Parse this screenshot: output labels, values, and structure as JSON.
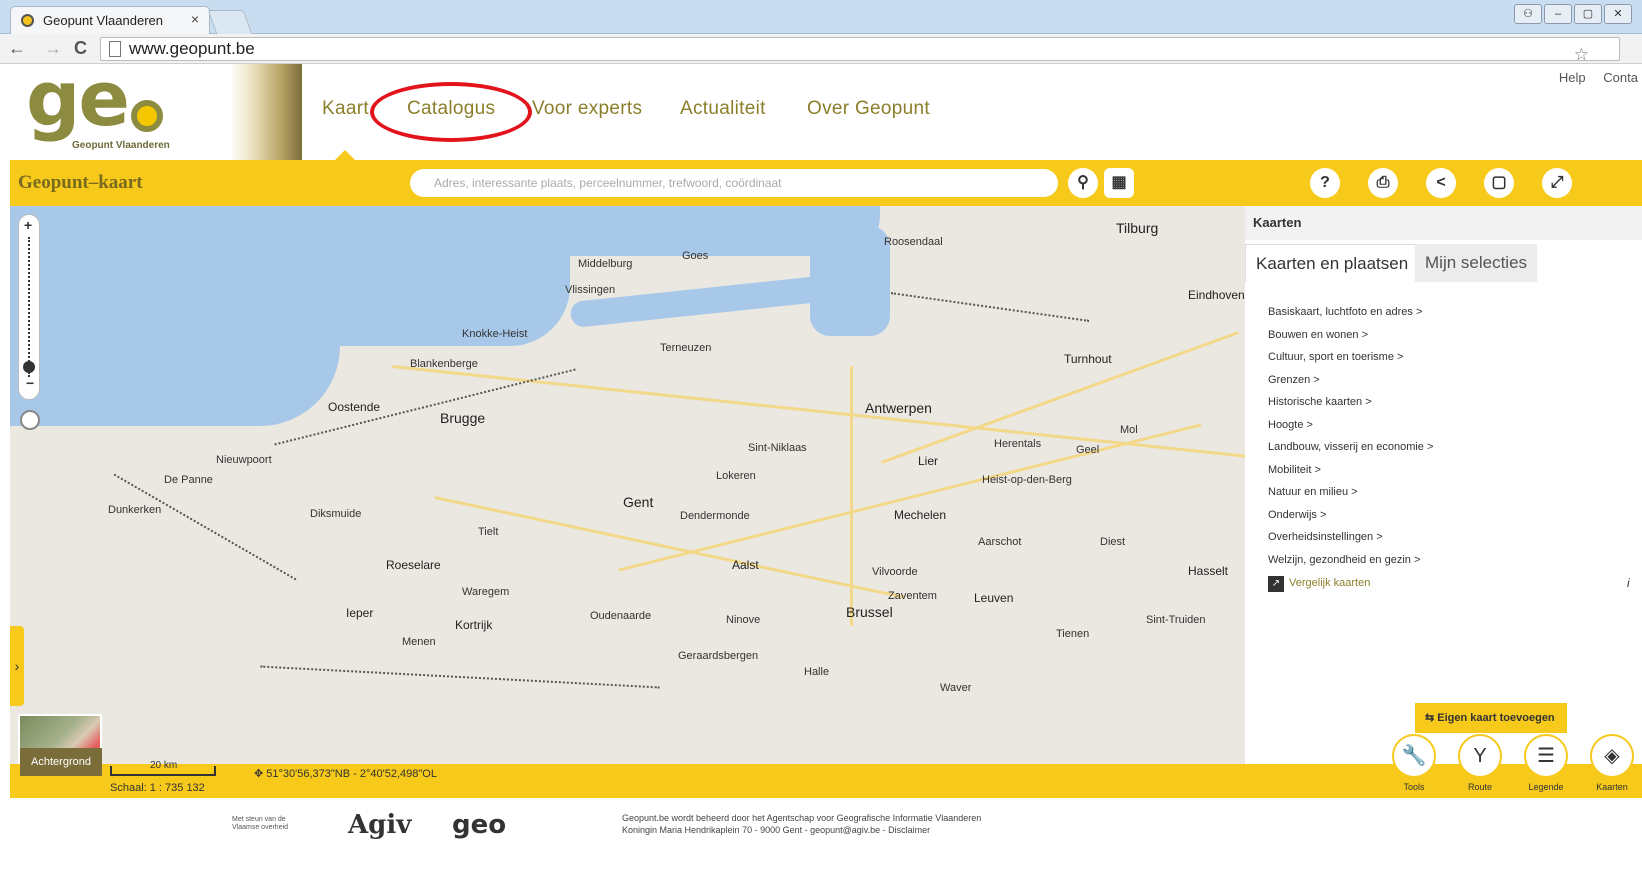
{
  "browser": {
    "tab_title": "Geopunt Vlaanderen",
    "tab_close": "×",
    "url": "www.geopunt.be",
    "back": "←",
    "forward": "→",
    "reload": "C",
    "star": "☆"
  },
  "site": {
    "logo_text": "ge",
    "logo_sub": "Geopunt Vlaanderen",
    "nav": [
      "Kaart",
      "Catalogus",
      "Voor experts",
      "Actualiteit",
      "Over Geopunt"
    ],
    "top_links": [
      "Help",
      "Conta"
    ]
  },
  "toolbar": {
    "title": "Geopunt–kaart",
    "search_placeholder": "Adres, interessante plaats, perceelnummer, trefwoord, coördinaat",
    "help": "?",
    "print": "⎙",
    "share": "<",
    "frame": "▢",
    "fullscreen": "⤢"
  },
  "map": {
    "zoom_in": "+",
    "zoom_out": "−",
    "cities": [
      {
        "name": "Brugge"
      },
      {
        "name": "Gent"
      },
      {
        "name": "Antwerpen"
      },
      {
        "name": "Brussel"
      },
      {
        "name": "Mechelen"
      },
      {
        "name": "Leuven"
      },
      {
        "name": "Oostende"
      },
      {
        "name": "Tilburg"
      },
      {
        "name": "Eindhoven"
      },
      {
        "name": "Kortrijk"
      },
      {
        "name": "Aalst"
      },
      {
        "name": "Roeselare"
      },
      {
        "name": "Ieper"
      },
      {
        "name": "Hasselt"
      },
      {
        "name": "Turnhout"
      },
      {
        "name": "Lier"
      }
    ],
    "places": [
      {
        "name": "Middelburg"
      },
      {
        "name": "Vlissingen"
      },
      {
        "name": "Goes"
      },
      {
        "name": "Roosendaal"
      },
      {
        "name": "Terneuzen"
      },
      {
        "name": "Knokke-Heist"
      },
      {
        "name": "Blankenberge"
      },
      {
        "name": "Sint-Niklaas"
      },
      {
        "name": "Dendermonde"
      },
      {
        "name": "Lokeren"
      },
      {
        "name": "Vilvoorde"
      },
      {
        "name": "Zaventem"
      },
      {
        "name": "Tienen"
      },
      {
        "name": "Sint-Truiden"
      },
      {
        "name": "Geel"
      },
      {
        "name": "Herentals"
      },
      {
        "name": "Waregem"
      },
      {
        "name": "Tielt"
      },
      {
        "name": "Diksmuide"
      },
      {
        "name": "Nieuwpoort"
      },
      {
        "name": "De Panne"
      },
      {
        "name": "Dunkerken"
      },
      {
        "name": "Menen"
      },
      {
        "name": "Oudenaarde"
      },
      {
        "name": "Ninove"
      },
      {
        "name": "Geraardsbergen"
      },
      {
        "name": "Halle"
      },
      {
        "name": "Waver"
      },
      {
        "name": "Heist-op-den-Berg"
      },
      {
        "name": "Aarschot"
      },
      {
        "name": "Diest"
      },
      {
        "name": "Mol"
      }
    ]
  },
  "map_footer": {
    "background_label": "Achtergrond",
    "scale_text": "20 km",
    "scale_ratio": "Schaal: 1 : 735 132",
    "coordinates": "51°30'56,373\"NB - 2°40'52,498\"OL",
    "tools": [
      {
        "label": "Tools",
        "icon": "wrench-icon",
        "glyph": "🔧"
      },
      {
        "label": "Route",
        "icon": "route-icon",
        "glyph": "Y"
      },
      {
        "label": "Legende",
        "icon": "legend-icon",
        "glyph": "☰"
      },
      {
        "label": "Kaarten",
        "icon": "layers-icon",
        "glyph": "◈"
      }
    ]
  },
  "panel": {
    "header": "Kaarten",
    "tab_active": "Kaarten en plaatsen",
    "tab_inactive": "Mijn selecties",
    "categories": [
      "Basiskaart, luchtfoto en adres >",
      "Bouwen en wonen >",
      "Cultuur, sport en toerisme >",
      "Grenzen >",
      "Historische kaarten >",
      "Hoogte >",
      "Landbouw, visserij en economie >",
      "Mobiliteit >",
      "Natuur en milieu >",
      "Onderwijs >",
      "Overheidsinstellingen >",
      "Welzijn, gezondheid en gezin >"
    ],
    "compare_label": "Vergelijk kaarten",
    "compare_info": "i",
    "add_map": "Eigen kaart toevoegen"
  },
  "footer": {
    "logo1_line1": "Met steun van de",
    "logo1_line2": "Vlaamse overheid",
    "logo2": "Agiv",
    "logo3": "geo",
    "text_line1": "Geopunt.be wordt beheerd door het Agentschap voor Geografische Informatie Vlaanderen",
    "text_line2": "Koningin Maria Hendrikaplein 70 - 9000 Gent - geopunt@agiv.be - Disclaimer"
  },
  "colors": {
    "brand_yellow": "#f6c91a",
    "brand_olive": "#8d8b3f",
    "water": "#a8c8ea",
    "annotation_red": "#e2131b"
  }
}
